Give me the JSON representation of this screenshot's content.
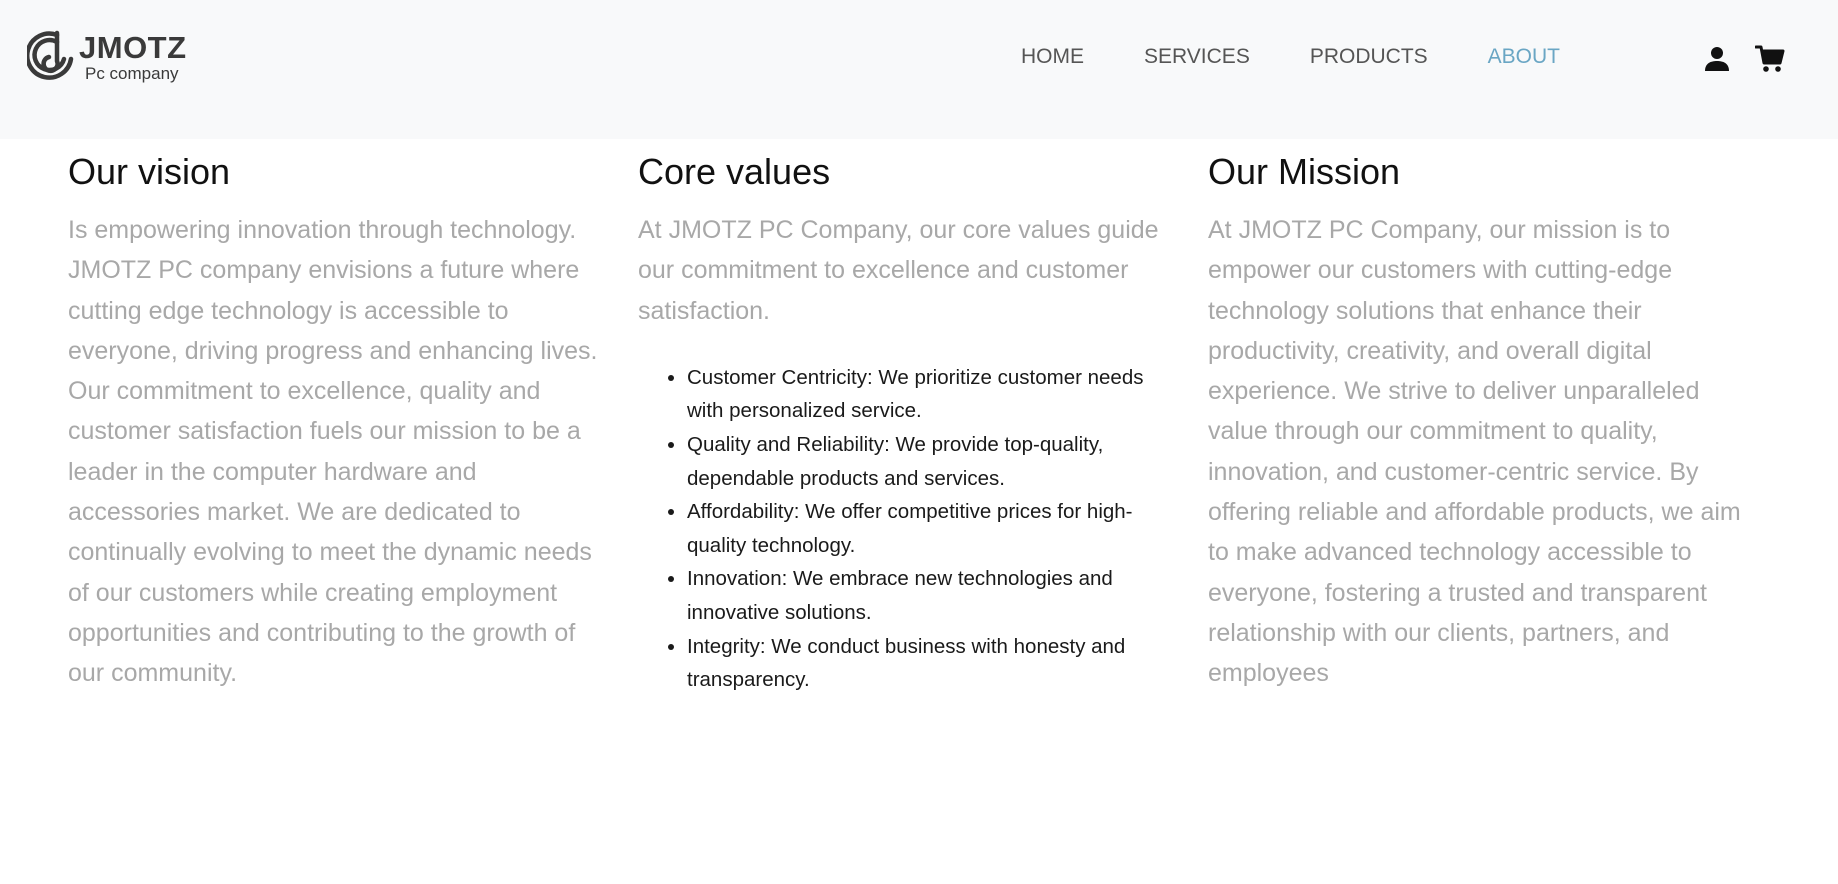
{
  "brand": {
    "name": "JMOTZ",
    "tagline": "Pc company",
    "logo_icon": "jmotz-logo-mark"
  },
  "nav": {
    "items": [
      {
        "label": "HOME",
        "active": false
      },
      {
        "label": "SERVICES",
        "active": false
      },
      {
        "label": "PRODUCTS",
        "active": false
      },
      {
        "label": "ABOUT",
        "active": true
      }
    ],
    "active_color": "#6aa6c4"
  },
  "header_icons": {
    "account": "user-icon",
    "cart": "cart-icon"
  },
  "vision": {
    "heading": "Our vision",
    "text": "Is empowering innovation through technology. JMOTZ PC company envisions a future where cutting edge technology is accessible to everyone, driving progress and enhancing lives. Our commitment to excellence, quality and customer satisfaction fuels our mission to be a leader in the computer hardware and accessories market. We are dedicated to continually evolving to meet the dynamic needs of our customers while creating employment opportunities and contributing to the growth of our community."
  },
  "core_values": {
    "heading": "Core values",
    "intro": "At JMOTZ PC Company, our core values guide our commitment to excellence and customer satisfaction.",
    "items": [
      "Customer Centricity: We prioritize customer needs with personalized service.",
      "Quality and Reliability: We provide top-quality, dependable products and services.",
      "Affordability: We offer competitive prices for high-quality technology.",
      "Innovation: We embrace new technologies and innovative solutions.",
      "Integrity: We conduct business with honesty and transparency."
    ]
  },
  "mission": {
    "heading": "Our Mission",
    "text": "At JMOTZ PC Company, our mission is to empower our customers with cutting-edge technology solutions that enhance their productivity, creativity, and overall digital experience. We strive to deliver unparalleled value through our commitment to quality, innovation, and customer-centric service. By offering reliable and affordable products, we aim to make advanced technology accessible to everyone, fostering a trusted and transparent relationship with our clients, partners, and employees"
  }
}
